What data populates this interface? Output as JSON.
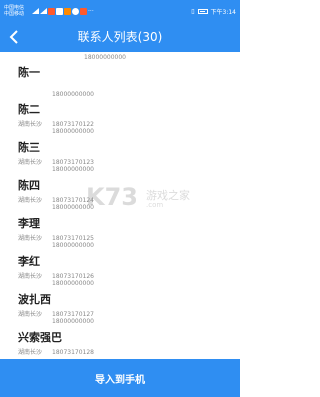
{
  "status_bar": {
    "carrier_line1": "中国电信",
    "carrier_line2": "中国移动",
    "time": "下午3:14"
  },
  "header": {
    "back_icon": "chevron-left-icon",
    "title": "联系人列表(30)"
  },
  "list": {
    "partial_top_number": "18000000000",
    "contacts": [
      {
        "name": "陈一",
        "location": "",
        "phone1": "",
        "phone2": "18000000000"
      },
      {
        "name": "陈二",
        "location": "湖南长沙",
        "phone1": "18073170122",
        "phone2": "18000000000"
      },
      {
        "name": "陈三",
        "location": "湖南长沙",
        "phone1": "18073170123",
        "phone2": "18000000000"
      },
      {
        "name": "陈四",
        "location": "湖南长沙",
        "phone1": "18073170124",
        "phone2": "18000000000"
      },
      {
        "name": "李理",
        "location": "湖南长沙",
        "phone1": "18073170125",
        "phone2": "18000000000"
      },
      {
        "name": "李红",
        "location": "湖南长沙",
        "phone1": "18073170126",
        "phone2": "18000000000"
      },
      {
        "name": "波扎西",
        "location": "湖南长沙",
        "phone1": "18073170127",
        "phone2": "18000000000"
      },
      {
        "name": "兴索强巴",
        "location": "湖南长沙",
        "phone1": "18073170128",
        "phone2": ""
      }
    ]
  },
  "watermark": {
    "logo": "K73",
    "text": "游戏之家",
    "sub": ".com"
  },
  "footer": {
    "import_label": "导入到手机"
  },
  "colors": {
    "primary": "#2f8ef2",
    "text_dark": "#222222",
    "text_gray": "#888888"
  }
}
